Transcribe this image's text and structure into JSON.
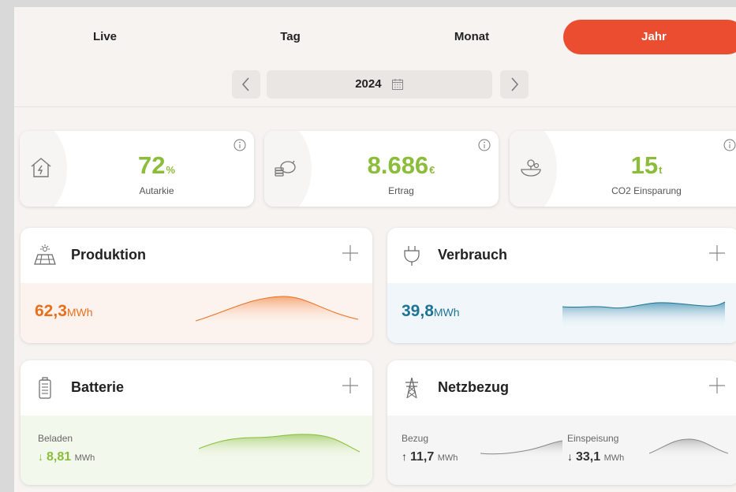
{
  "tabs": [
    "Live",
    "Tag",
    "Monat",
    "Jahr"
  ],
  "active_tab": "Jahr",
  "period": {
    "year": "2024",
    "prev_icon": "chevron-left-icon",
    "next_icon": "chevron-right-icon",
    "calendar_icon": "calendar-icon"
  },
  "kpis": [
    {
      "value": "72",
      "unit": "%",
      "label": "Autarkie",
      "icon": "house-energy-icon"
    },
    {
      "value": "8.686",
      "unit": "€",
      "label": "Ertrag",
      "icon": "piggy-bank-coins-icon"
    },
    {
      "value": "15",
      "unit": "t",
      "label": "CO2 Einsparung",
      "icon": "earth-tree-icon"
    }
  ],
  "produktion": {
    "title": "Produktion",
    "value": "62,3",
    "unit": "MWh",
    "icon": "solar-panel-icon"
  },
  "verbrauch": {
    "title": "Verbrauch",
    "value": "39,8",
    "unit": "MWh",
    "icon": "plug-icon"
  },
  "batterie": {
    "title": "Batterie",
    "label": "Beladen",
    "value": "8,81",
    "unit": "MWh",
    "icon": "battery-icon"
  },
  "netzbezug": {
    "title": "Netzbezug",
    "bezug_label": "Bezug",
    "bezug_value": "11,7",
    "bezug_unit": "MWh",
    "einspeisung_label": "Einspeisung",
    "einspeisung_value": "33,1",
    "einspeisung_unit": "MWh",
    "icon": "power-tower-icon"
  },
  "colors": {
    "accent": "#ea4d2f",
    "green": "#8bbd3b",
    "orange": "#e8701d",
    "blue": "#1e7494"
  }
}
